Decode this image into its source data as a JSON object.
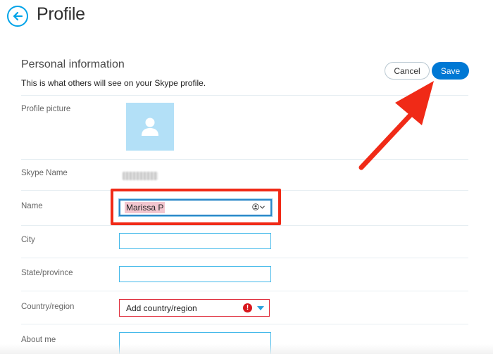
{
  "header": {
    "title": "Profile"
  },
  "section": {
    "title": "Personal information",
    "subtitle": "This is what others will see on your Skype profile."
  },
  "actions": {
    "cancel_label": "Cancel",
    "save_label": "Save"
  },
  "fields": {
    "profile_picture_label": "Profile picture",
    "skype_name_label": "Skype Name",
    "name_label": "Name",
    "name_value": "Marissa P",
    "city_label": "City",
    "city_value": "",
    "state_label": "State/province",
    "state_value": "",
    "country_label": "Country/region",
    "country_placeholder": "Add country/region",
    "about_label": "About me",
    "about_value": ""
  },
  "colors": {
    "accent": "#0078d4",
    "input_border": "#44b9ea",
    "error": "#d8171d",
    "annotation": "#f02a17"
  },
  "icons": {
    "back": "arrow-left-icon",
    "avatar": "person-icon",
    "contact_picker": "person-circle-icon",
    "error": "exclamation-icon",
    "dropdown": "caret-down-icon"
  }
}
